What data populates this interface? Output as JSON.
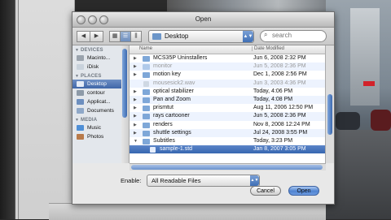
{
  "window": {
    "title": "Open"
  },
  "toolbar": {
    "back": "◀",
    "forward": "▶",
    "view_icon": "▦",
    "view_list": "☰",
    "view_columns": "⫼",
    "location": "Desktop",
    "search_placeholder": "search",
    "search_icon": "⌕"
  },
  "sidebar": {
    "devices_heading": "DEVICES",
    "devices": [
      {
        "label": "Macinto...",
        "icon": "hard-drive-icon"
      },
      {
        "label": "iDisk",
        "icon": "idisk-icon"
      }
    ],
    "places_heading": "PLACES",
    "places": [
      {
        "label": "Desktop",
        "icon": "desktop-icon",
        "selected": true
      },
      {
        "label": "contour",
        "icon": "home-icon"
      },
      {
        "label": "Applicat...",
        "icon": "applications-icon"
      },
      {
        "label": "Documents",
        "icon": "documents-icon"
      }
    ],
    "media_heading": "MEDIA",
    "media": [
      {
        "label": "Music",
        "icon": "music-icon"
      },
      {
        "label": "Photos",
        "icon": "photos-icon"
      }
    ]
  },
  "file_list": {
    "col_name": "Name",
    "col_date": "Date Modified",
    "rows": [
      {
        "name": "MCS35P Uninstallers",
        "date": "Jun 6, 2008 2:32 PM",
        "type": "folder",
        "disabled": false
      },
      {
        "name": "monitor",
        "date": "Jun 5, 2008 2:36 PM",
        "type": "folder",
        "disabled": true
      },
      {
        "name": "motion key",
        "date": "Dec 1, 2008 2:56 PM",
        "type": "folder",
        "disabled": false
      },
      {
        "name": "mousesick2.wav",
        "date": "Jun 3, 2003 4:36 PM",
        "type": "file",
        "disabled": true
      },
      {
        "name": "optical stabilizer",
        "date": "Today, 4:06 PM",
        "type": "folder",
        "disabled": false
      },
      {
        "name": "Pan and Zoom",
        "date": "Today, 4:08 PM",
        "type": "folder",
        "disabled": false
      },
      {
        "name": "prismtut",
        "date": "Aug 11, 2006 12:50 PM",
        "type": "folder",
        "disabled": false
      },
      {
        "name": "rays cartooner",
        "date": "Jun 5, 2008 2:36 PM",
        "type": "folder",
        "disabled": false
      },
      {
        "name": "renders",
        "date": "Nov 8, 2008 12:24 PM",
        "type": "folder",
        "disabled": false
      },
      {
        "name": "shuttle settings",
        "date": "Jul 24, 2008 3:55 PM",
        "type": "folder",
        "disabled": false
      },
      {
        "name": "Subtitles",
        "date": "Today, 3:23 PM",
        "type": "folder",
        "disabled": false,
        "expanded": true
      },
      {
        "name": "sample-1.std",
        "date": "Jan 8, 2007 3:05 PM",
        "type": "file",
        "selected": true,
        "indent": true
      }
    ]
  },
  "footer": {
    "enable_label": "Enable:",
    "enable_value": "All Readable Files",
    "cancel_label": "Cancel",
    "open_label": "Open"
  },
  "colors": {
    "selection": "#3f66a8",
    "folder": "#7ea7d8",
    "accent_button": "#4f83d1"
  }
}
